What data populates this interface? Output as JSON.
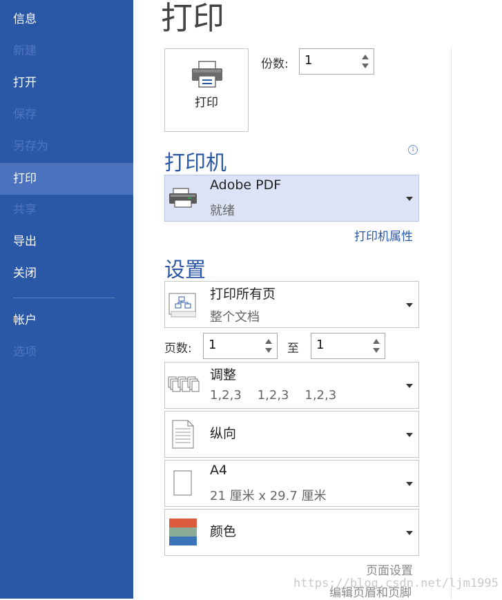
{
  "sidebar": {
    "items": [
      {
        "label": "信息"
      },
      {
        "label": "新建"
      },
      {
        "label": "打开"
      },
      {
        "label": "保存"
      },
      {
        "label": "另存为"
      },
      {
        "label": "打印"
      },
      {
        "label": "共享"
      },
      {
        "label": "导出"
      },
      {
        "label": "关闭"
      },
      {
        "label": "帐户"
      },
      {
        "label": "选项"
      }
    ]
  },
  "page": {
    "title": "打印"
  },
  "print_button": {
    "label": "打印"
  },
  "copies": {
    "label": "份数:",
    "value": "1"
  },
  "printer": {
    "section_title": "打印机",
    "info_icon": "i",
    "name": "Adobe PDF",
    "status": "就绪",
    "properties_link": "打印机属性"
  },
  "settings": {
    "section_title": "设置",
    "print_range": {
      "title": "打印所有页",
      "subtitle": "整个文档"
    },
    "pages": {
      "label": "页数:",
      "from": "1",
      "to_label": "至",
      "to": "1"
    },
    "collate": {
      "title": "调整",
      "subtitle": "1,2,3    1,2,3    1,2,3"
    },
    "orientation": {
      "title": "纵向"
    },
    "paper": {
      "title": "A4",
      "subtitle": "21 厘米 x 29.7 厘米"
    },
    "color": {
      "title": "颜色"
    },
    "page_setup_link": "页面设置",
    "header_footer_link": "编辑页眉和页脚"
  },
  "watermark": "https://blog.csdn.net/ljm1995",
  "colors": {
    "sidebar": "#2b57a7",
    "accent": "#2b57a7",
    "highlight": "#dce3f6"
  }
}
